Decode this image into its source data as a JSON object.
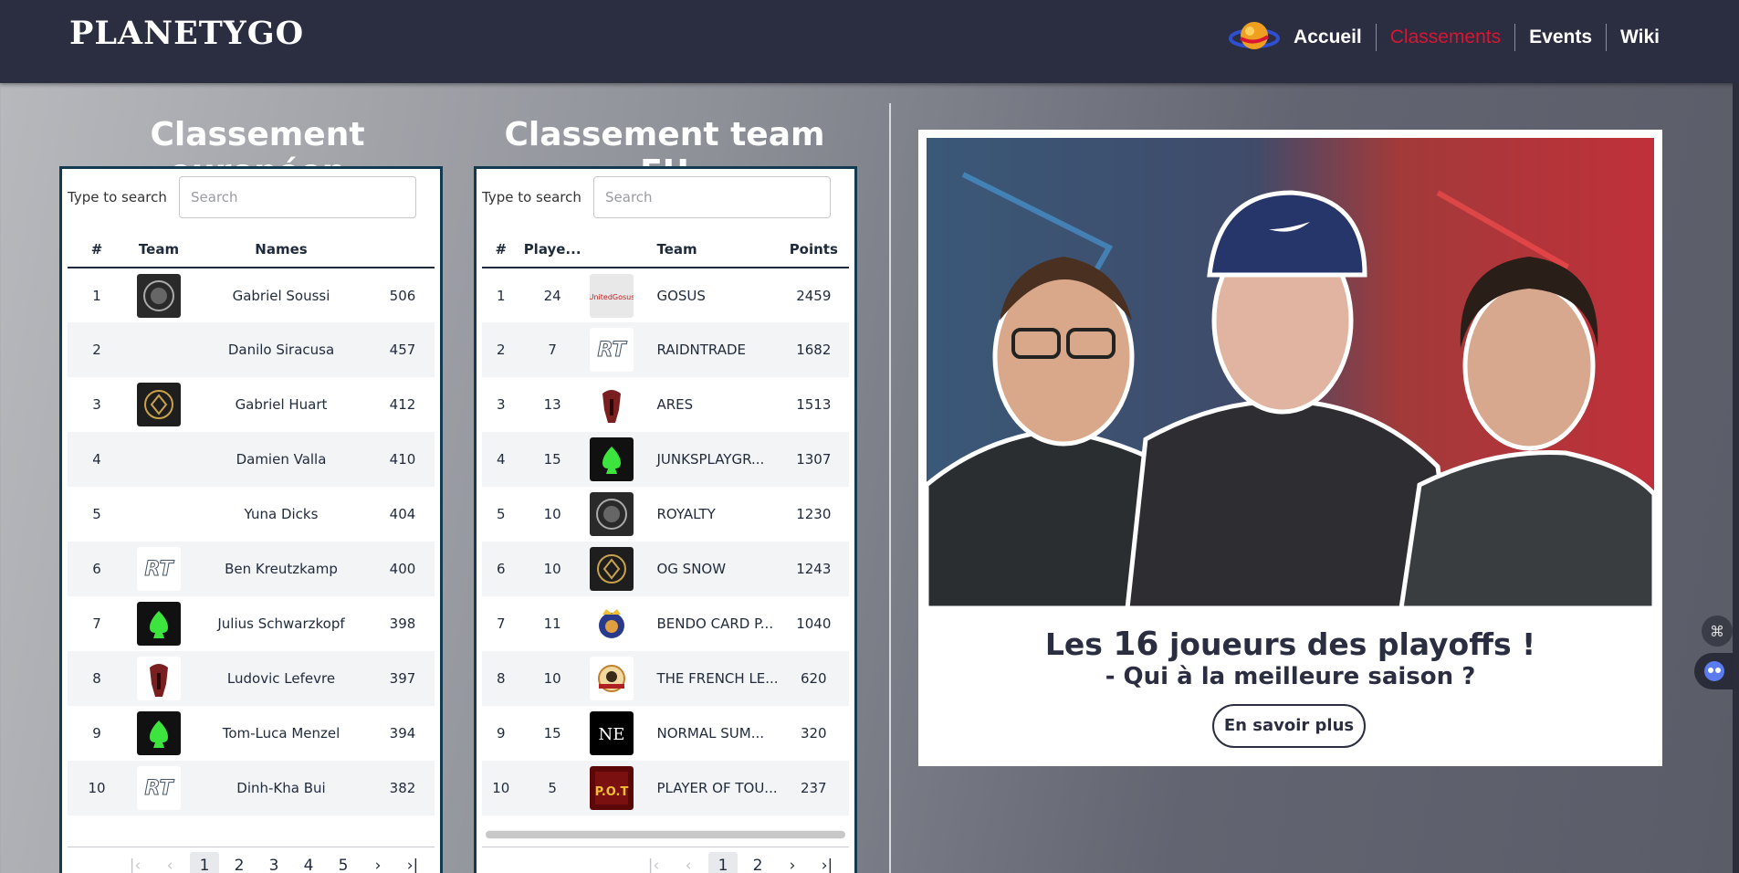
{
  "header": {
    "logo": "PLANETYGO",
    "nav": [
      {
        "label": "Accueil",
        "active": false
      },
      {
        "label": "Classements",
        "active": true
      },
      {
        "label": "Events",
        "active": false
      },
      {
        "label": "Wiki",
        "active": false
      }
    ]
  },
  "colors": {
    "header_bg": "#2b2d40",
    "accent": "#d81634",
    "panel_border": "#123a51"
  },
  "european": {
    "title": "Classement européen",
    "search_label": "Type to search",
    "search_placeholder": "Search",
    "columns": [
      "#",
      "Team",
      "Names",
      ""
    ],
    "rows": [
      {
        "rank": "1",
        "logo": "royalty",
        "name": "Gabriel Soussi",
        "points": "506"
      },
      {
        "rank": "2",
        "logo": "",
        "name": "Danilo Siracusa",
        "points": "457"
      },
      {
        "rank": "3",
        "logo": "og-snow",
        "name": "Gabriel Huart",
        "points": "412"
      },
      {
        "rank": "4",
        "logo": "",
        "name": "Damien Valla",
        "points": "410"
      },
      {
        "rank": "5",
        "logo": "",
        "name": "Yuna Dicks",
        "points": "404"
      },
      {
        "rank": "6",
        "logo": "rt",
        "name": "Ben Kreutzkamp",
        "points": "400"
      },
      {
        "rank": "7",
        "logo": "junks",
        "name": "Julius Schwarzkopf",
        "points": "398"
      },
      {
        "rank": "8",
        "logo": "ares",
        "name": "Ludovic Lefevre",
        "points": "397"
      },
      {
        "rank": "9",
        "logo": "junks",
        "name": "Tom-Luca Menzel",
        "points": "394"
      },
      {
        "rank": "10",
        "logo": "rt",
        "name": "Dinh-Kha Bui",
        "points": "382"
      }
    ],
    "pages": [
      "1",
      "2",
      "3",
      "4",
      "5"
    ],
    "current_page": "1"
  },
  "team": {
    "title": "Classement team EU",
    "search_label": "Type to search",
    "search_placeholder": "Search",
    "columns": [
      "#",
      "Playe...",
      "Team",
      "Points"
    ],
    "rows": [
      {
        "rank": "1",
        "players": "24",
        "logo": "gosus",
        "team": "GOSUS",
        "points": "2459"
      },
      {
        "rank": "2",
        "players": "7",
        "logo": "rt",
        "team": "RAIDNTRADE",
        "points": "1682"
      },
      {
        "rank": "3",
        "players": "13",
        "logo": "ares",
        "team": "ARES",
        "points": "1513"
      },
      {
        "rank": "4",
        "players": "15",
        "logo": "junks",
        "team": "JUNKSPLAYGR...",
        "points": "1307"
      },
      {
        "rank": "5",
        "players": "10",
        "logo": "royalty",
        "team": "ROYALTY",
        "points": "1230"
      },
      {
        "rank": "6",
        "players": "10",
        "logo": "og-snow",
        "team": "OG SNOW",
        "points": "1243"
      },
      {
        "rank": "7",
        "players": "11",
        "logo": "bendo",
        "team": "BENDO CARD P...",
        "points": "1040"
      },
      {
        "rank": "8",
        "players": "10",
        "logo": "french",
        "team": "THE FRENCH LE...",
        "points": "620"
      },
      {
        "rank": "9",
        "players": "15",
        "logo": "normal",
        "team": "NORMAL SUM...",
        "points": "320"
      },
      {
        "rank": "10",
        "players": "5",
        "logo": "pot",
        "team": "PLAYER OF TOU...",
        "points": "237"
      }
    ],
    "pages": [
      "1",
      "2"
    ],
    "current_page": "1"
  },
  "promo": {
    "title_pre": "Les ",
    "title_num": "16",
    "title_post": " joueurs des playoffs !",
    "subtitle": "- Qui à la meilleure saison ?",
    "button": "En savoir plus"
  }
}
